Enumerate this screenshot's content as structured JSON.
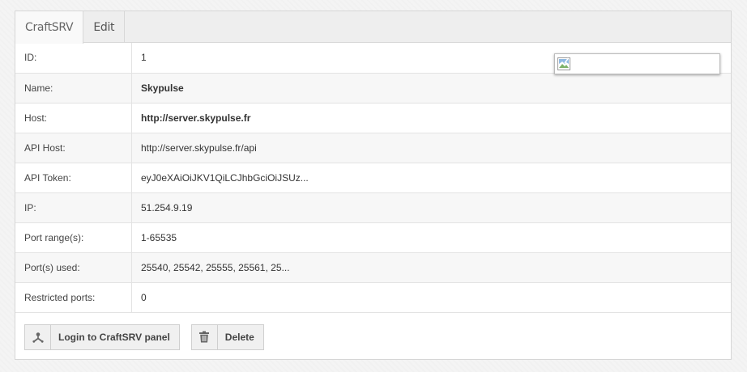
{
  "tabs": [
    {
      "label": "CraftSRV"
    },
    {
      "label": "Edit"
    }
  ],
  "rows": [
    {
      "label": "ID:",
      "value": "1"
    },
    {
      "label": "Name:",
      "value": "Skypulse"
    },
    {
      "label": "Host:",
      "value": "http://server.skypulse.fr"
    },
    {
      "label": "API Host:",
      "value": "http://server.skypulse.fr/api"
    },
    {
      "label": "API Token:",
      "value": "eyJ0eXAiOiJKV1QiLCJhbGciOiJSUz..."
    },
    {
      "label": "IP:",
      "value": "51.254.9.19"
    },
    {
      "label": "Port range(s):",
      "value": "1-65535"
    },
    {
      "label": "Port(s) used:",
      "value": "25540, 25542, 25555, 25561, 25..."
    },
    {
      "label": "Restricted ports:",
      "value": "0"
    }
  ],
  "actions": {
    "login_label": "Login to CraftSRV panel",
    "login_icon": "fork-icon",
    "delete_label": "Delete",
    "delete_icon": "trash-icon"
  },
  "colors": {
    "link_green": "#3b8a2f"
  }
}
